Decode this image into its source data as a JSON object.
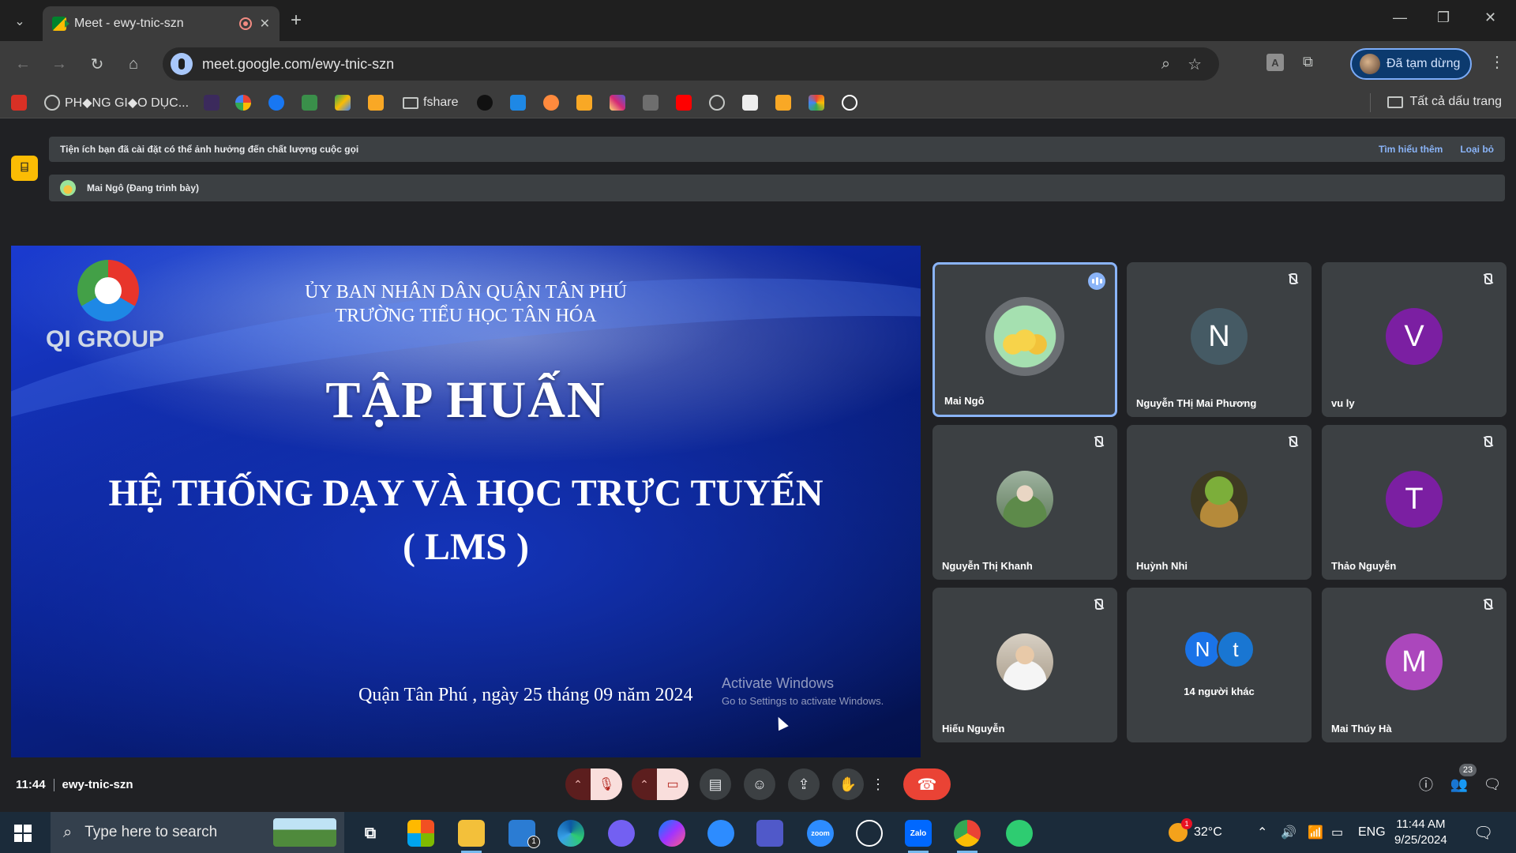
{
  "browser": {
    "tab_title": "Meet - ewy-tnic-szn",
    "url": "meet.google.com/ewy-tnic-szn",
    "profile_label": "Đã tạm dừng",
    "bookmarks": [
      {
        "label": "PH◆NG GI◆O DỤC..."
      },
      {
        "label": "fshare"
      }
    ],
    "all_bookmarks": "Tất cả dấu trang"
  },
  "meet": {
    "notice_text": "Tiện ích bạn đã cài đặt có thể ảnh hưởng đến chất lượng cuộc gọi",
    "notice_learn_more": "Tìm hiểu thêm",
    "notice_dismiss": "Loại bỏ",
    "presenting": "Mai Ngô (Đang trình bày)",
    "slide": {
      "logo_text": "QI GROUP",
      "header_line1": "ỦY BAN NHÂN DÂN QUẬN TÂN PHÚ",
      "header_line2": "TRƯỜNG TIỂU HỌC TÂN HÓA",
      "title": "TẬP HUẤN",
      "subtitle_line1": "HỆ THỐNG DẠY VÀ HỌC TRỰC TUYẾN",
      "subtitle_line2": "( LMS )",
      "date_line": "Quận Tân Phú , ngày 25 tháng 09 năm 2024",
      "activate_title": "Activate Windows",
      "activate_sub": "Go to Settings to activate Windows."
    },
    "participants": [
      {
        "name": "Mai Ngô",
        "initial": "",
        "color": "#5f6368"
      },
      {
        "name": "Nguyễn THị Mai Phương",
        "initial": "N",
        "color": "#455a64"
      },
      {
        "name": "vu ly",
        "initial": "V",
        "color": "#7b1fa2"
      },
      {
        "name": "Nguyễn Thị Khanh",
        "initial": "",
        "color": "#6d7f5a"
      },
      {
        "name": "Huỳnh Nhi",
        "initial": "",
        "color": "#6a5a2a"
      },
      {
        "name": "Thảo Nguyễn",
        "initial": "T",
        "color": "#7b1fa2"
      },
      {
        "name": "Hiếu Nguyễn",
        "initial": "",
        "color": "#d8d0c4"
      },
      {
        "name": "Mai Thúy Hà",
        "initial": "M",
        "color": "#ab47bc"
      }
    ],
    "others": {
      "initials": [
        "N",
        "t"
      ],
      "label": "14 người khác"
    },
    "time": "11:44",
    "meeting_code": "ewy-tnic-szn",
    "people_count": "23"
  },
  "taskbar": {
    "search_placeholder": "Type here to search",
    "temperature": "32°C",
    "language": "ENG",
    "time": "11:44 AM",
    "date": "9/25/2024",
    "mail_badge": "1",
    "weather_badge": "1"
  }
}
